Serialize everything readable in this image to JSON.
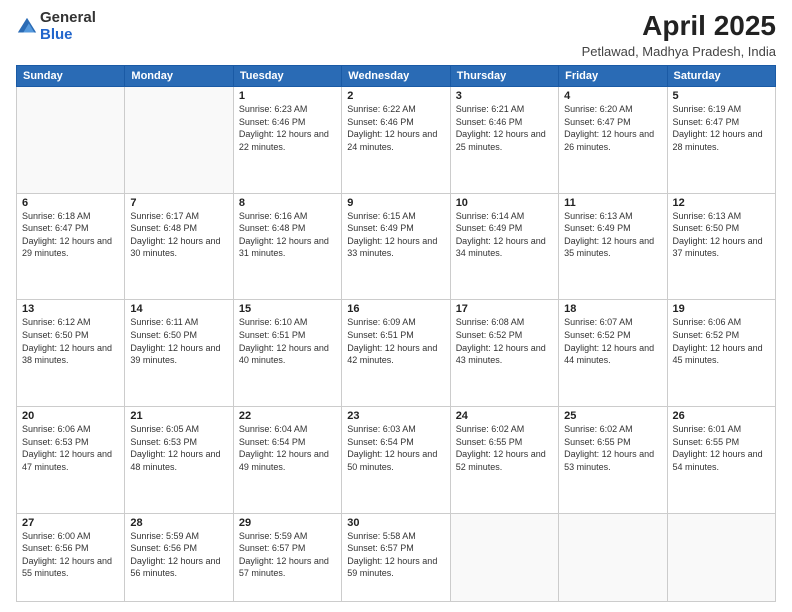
{
  "header": {
    "logo_general": "General",
    "logo_blue": "Blue",
    "month_title": "April 2025",
    "location": "Petlawad, Madhya Pradesh, India"
  },
  "weekdays": [
    "Sunday",
    "Monday",
    "Tuesday",
    "Wednesday",
    "Thursday",
    "Friday",
    "Saturday"
  ],
  "weeks": [
    [
      {
        "day": "",
        "info": ""
      },
      {
        "day": "",
        "info": ""
      },
      {
        "day": "1",
        "info": "Sunrise: 6:23 AM\nSunset: 6:46 PM\nDaylight: 12 hours and 22 minutes."
      },
      {
        "day": "2",
        "info": "Sunrise: 6:22 AM\nSunset: 6:46 PM\nDaylight: 12 hours and 24 minutes."
      },
      {
        "day": "3",
        "info": "Sunrise: 6:21 AM\nSunset: 6:46 PM\nDaylight: 12 hours and 25 minutes."
      },
      {
        "day": "4",
        "info": "Sunrise: 6:20 AM\nSunset: 6:47 PM\nDaylight: 12 hours and 26 minutes."
      },
      {
        "day": "5",
        "info": "Sunrise: 6:19 AM\nSunset: 6:47 PM\nDaylight: 12 hours and 28 minutes."
      }
    ],
    [
      {
        "day": "6",
        "info": "Sunrise: 6:18 AM\nSunset: 6:47 PM\nDaylight: 12 hours and 29 minutes."
      },
      {
        "day": "7",
        "info": "Sunrise: 6:17 AM\nSunset: 6:48 PM\nDaylight: 12 hours and 30 minutes."
      },
      {
        "day": "8",
        "info": "Sunrise: 6:16 AM\nSunset: 6:48 PM\nDaylight: 12 hours and 31 minutes."
      },
      {
        "day": "9",
        "info": "Sunrise: 6:15 AM\nSunset: 6:49 PM\nDaylight: 12 hours and 33 minutes."
      },
      {
        "day": "10",
        "info": "Sunrise: 6:14 AM\nSunset: 6:49 PM\nDaylight: 12 hours and 34 minutes."
      },
      {
        "day": "11",
        "info": "Sunrise: 6:13 AM\nSunset: 6:49 PM\nDaylight: 12 hours and 35 minutes."
      },
      {
        "day": "12",
        "info": "Sunrise: 6:13 AM\nSunset: 6:50 PM\nDaylight: 12 hours and 37 minutes."
      }
    ],
    [
      {
        "day": "13",
        "info": "Sunrise: 6:12 AM\nSunset: 6:50 PM\nDaylight: 12 hours and 38 minutes."
      },
      {
        "day": "14",
        "info": "Sunrise: 6:11 AM\nSunset: 6:50 PM\nDaylight: 12 hours and 39 minutes."
      },
      {
        "day": "15",
        "info": "Sunrise: 6:10 AM\nSunset: 6:51 PM\nDaylight: 12 hours and 40 minutes."
      },
      {
        "day": "16",
        "info": "Sunrise: 6:09 AM\nSunset: 6:51 PM\nDaylight: 12 hours and 42 minutes."
      },
      {
        "day": "17",
        "info": "Sunrise: 6:08 AM\nSunset: 6:52 PM\nDaylight: 12 hours and 43 minutes."
      },
      {
        "day": "18",
        "info": "Sunrise: 6:07 AM\nSunset: 6:52 PM\nDaylight: 12 hours and 44 minutes."
      },
      {
        "day": "19",
        "info": "Sunrise: 6:06 AM\nSunset: 6:52 PM\nDaylight: 12 hours and 45 minutes."
      }
    ],
    [
      {
        "day": "20",
        "info": "Sunrise: 6:06 AM\nSunset: 6:53 PM\nDaylight: 12 hours and 47 minutes."
      },
      {
        "day": "21",
        "info": "Sunrise: 6:05 AM\nSunset: 6:53 PM\nDaylight: 12 hours and 48 minutes."
      },
      {
        "day": "22",
        "info": "Sunrise: 6:04 AM\nSunset: 6:54 PM\nDaylight: 12 hours and 49 minutes."
      },
      {
        "day": "23",
        "info": "Sunrise: 6:03 AM\nSunset: 6:54 PM\nDaylight: 12 hours and 50 minutes."
      },
      {
        "day": "24",
        "info": "Sunrise: 6:02 AM\nSunset: 6:55 PM\nDaylight: 12 hours and 52 minutes."
      },
      {
        "day": "25",
        "info": "Sunrise: 6:02 AM\nSunset: 6:55 PM\nDaylight: 12 hours and 53 minutes."
      },
      {
        "day": "26",
        "info": "Sunrise: 6:01 AM\nSunset: 6:55 PM\nDaylight: 12 hours and 54 minutes."
      }
    ],
    [
      {
        "day": "27",
        "info": "Sunrise: 6:00 AM\nSunset: 6:56 PM\nDaylight: 12 hours and 55 minutes."
      },
      {
        "day": "28",
        "info": "Sunrise: 5:59 AM\nSunset: 6:56 PM\nDaylight: 12 hours and 56 minutes."
      },
      {
        "day": "29",
        "info": "Sunrise: 5:59 AM\nSunset: 6:57 PM\nDaylight: 12 hours and 57 minutes."
      },
      {
        "day": "30",
        "info": "Sunrise: 5:58 AM\nSunset: 6:57 PM\nDaylight: 12 hours and 59 minutes."
      },
      {
        "day": "",
        "info": ""
      },
      {
        "day": "",
        "info": ""
      },
      {
        "day": "",
        "info": ""
      }
    ]
  ]
}
